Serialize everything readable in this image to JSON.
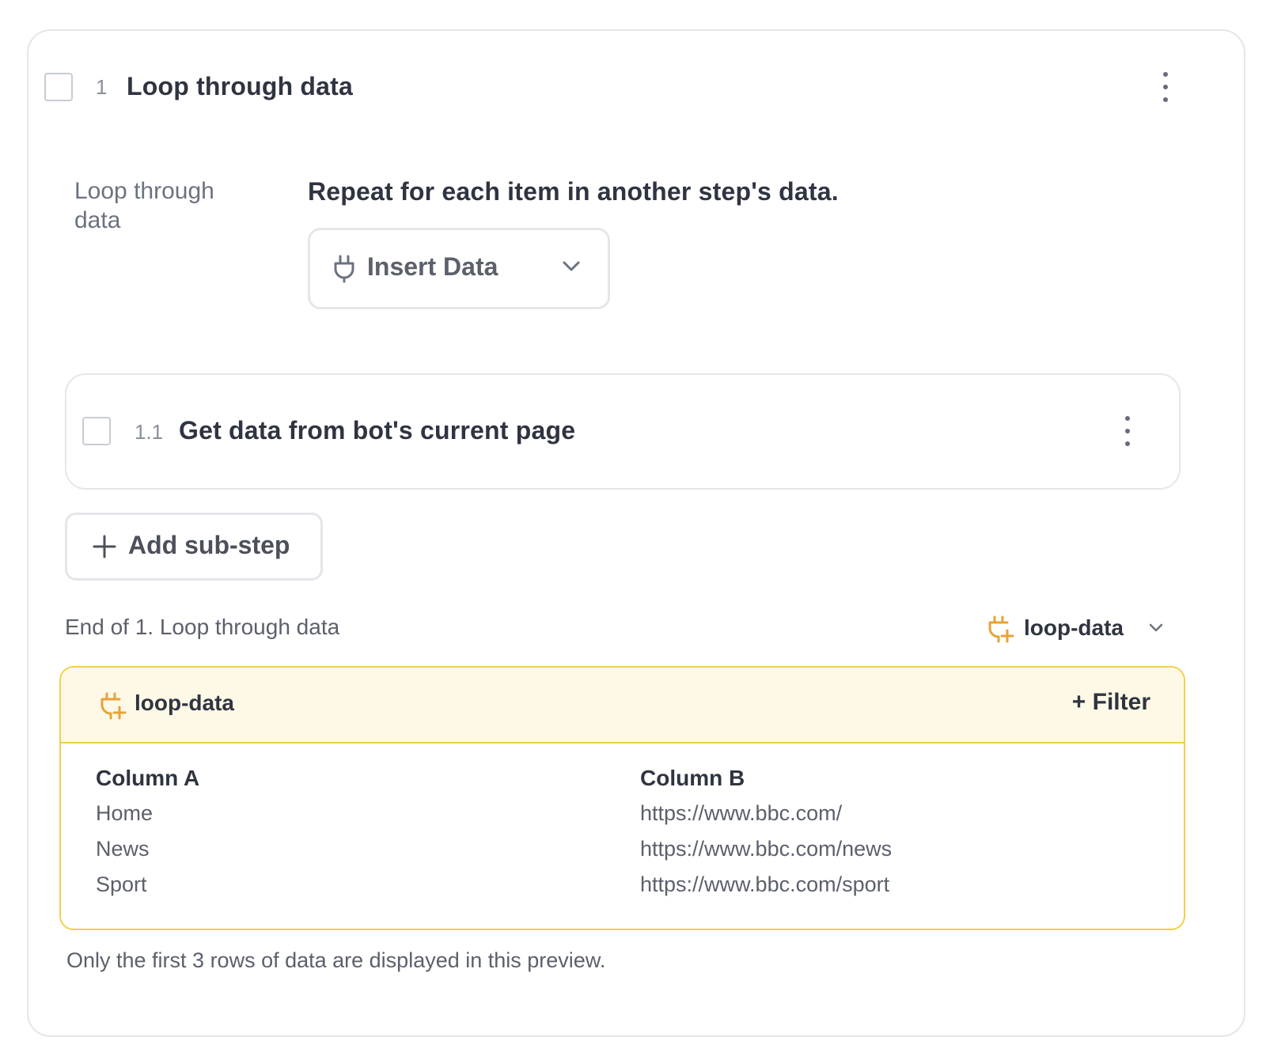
{
  "step": {
    "number": "1",
    "title": "Loop through data",
    "side_label": "Loop through data",
    "description": "Repeat for each item in another step's data.",
    "insert_data_label": "Insert Data"
  },
  "substep": {
    "number": "1.1",
    "title": "Get data from bot's current page"
  },
  "add_substep_label": "Add sub-step",
  "end_label": "End of 1. Loop through data",
  "loop_select": {
    "label": "loop-data",
    "icon": "plug-plus-icon",
    "accent": "#e8a23a"
  },
  "data_panel": {
    "name": "loop-data",
    "filter_label": "+ Filter",
    "header_bg": "#fef9e7",
    "border_color": "#f3cf4a",
    "columns": [
      {
        "header": "Column A",
        "values": [
          "Home",
          "News",
          "Sport"
        ]
      },
      {
        "header": "Column B",
        "values": [
          "https://www.bbc.com/",
          "https://www.bbc.com/news",
          "https://www.bbc.com/sport"
        ]
      }
    ]
  },
  "footnote": "Only the first 3 rows of data are displayed in this preview."
}
